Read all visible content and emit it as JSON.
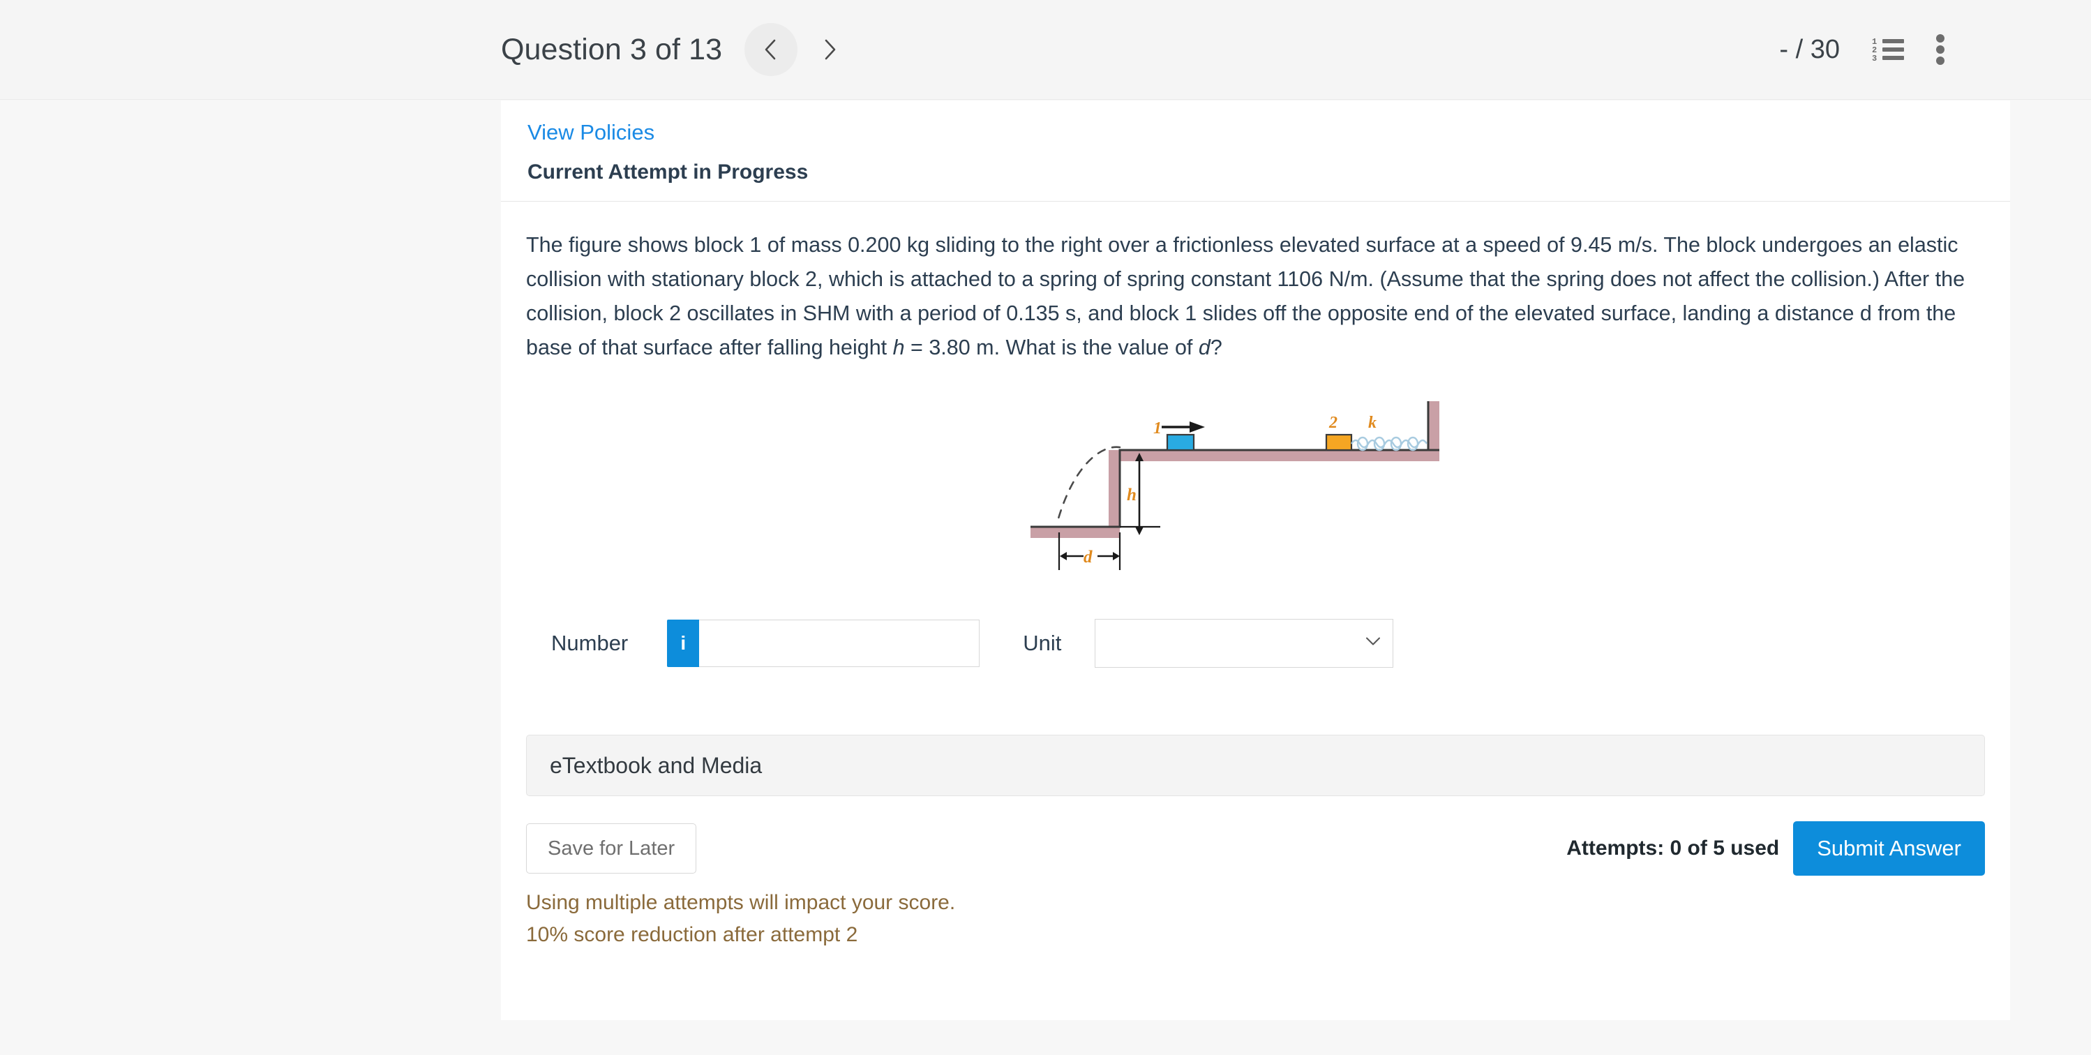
{
  "header": {
    "question_title": "Question 3 of 13",
    "prev_label": "Previous question",
    "next_label": "Next question",
    "score": "- / 30",
    "list_icon": "numbered-list-icon",
    "menu_icon": "kebab-menu-icon",
    "list_numbers": [
      "1",
      "2",
      "3"
    ]
  },
  "card": {
    "view_policies": "View Policies",
    "attempt_status": "Current Attempt in Progress",
    "question": {
      "part1": "The figure shows block 1 of mass 0.200 kg sliding to the right over a frictionless elevated surface at a speed of 9.45 m/s. The block undergoes an elastic collision with stationary block 2, which is attached to a spring of spring constant 1106 N/m. (Assume that the spring does not affect the collision.) After the collision, block 2 oscillates in SHM with a period of 0.135 s, and block 1 slides off the opposite end of the elevated surface, landing a distance d from the base of that surface after falling height ",
      "h_symbol": "h",
      "part2": " = 3.80 m. What is the value of ",
      "d_symbol": "d",
      "part3": "?",
      "mass": "0.200 kg",
      "speed": "9.45 m/s",
      "spring_constant": "1106 N/m",
      "period": "0.135 s",
      "height": "3.80 m"
    },
    "figure": {
      "block1_label": "1",
      "block2_label": "2",
      "spring_label": "k",
      "height_label": "h",
      "distance_label": "d",
      "block1_color": "#29abe2",
      "block2_color": "#f5a623",
      "surface_color": "#c9a0a6",
      "spring_color": "#a8cbe0",
      "label_color": "#e08a1e",
      "velocity_arrow": "rightward-arrow"
    },
    "answer": {
      "number_label": "Number",
      "info_badge": "i",
      "number_value": "",
      "number_placeholder": "",
      "unit_label": "Unit",
      "unit_value": "",
      "unit_options": [
        ""
      ]
    },
    "etextbook_label": "eTextbook and Media",
    "save_label": "Save for Later",
    "attempts_text": "Attempts: 0 of 5 used",
    "submit_label": "Submit Answer",
    "warning_line1": "Using multiple attempts will impact your score.",
    "warning_line2": "10% score reduction after attempt 2"
  }
}
